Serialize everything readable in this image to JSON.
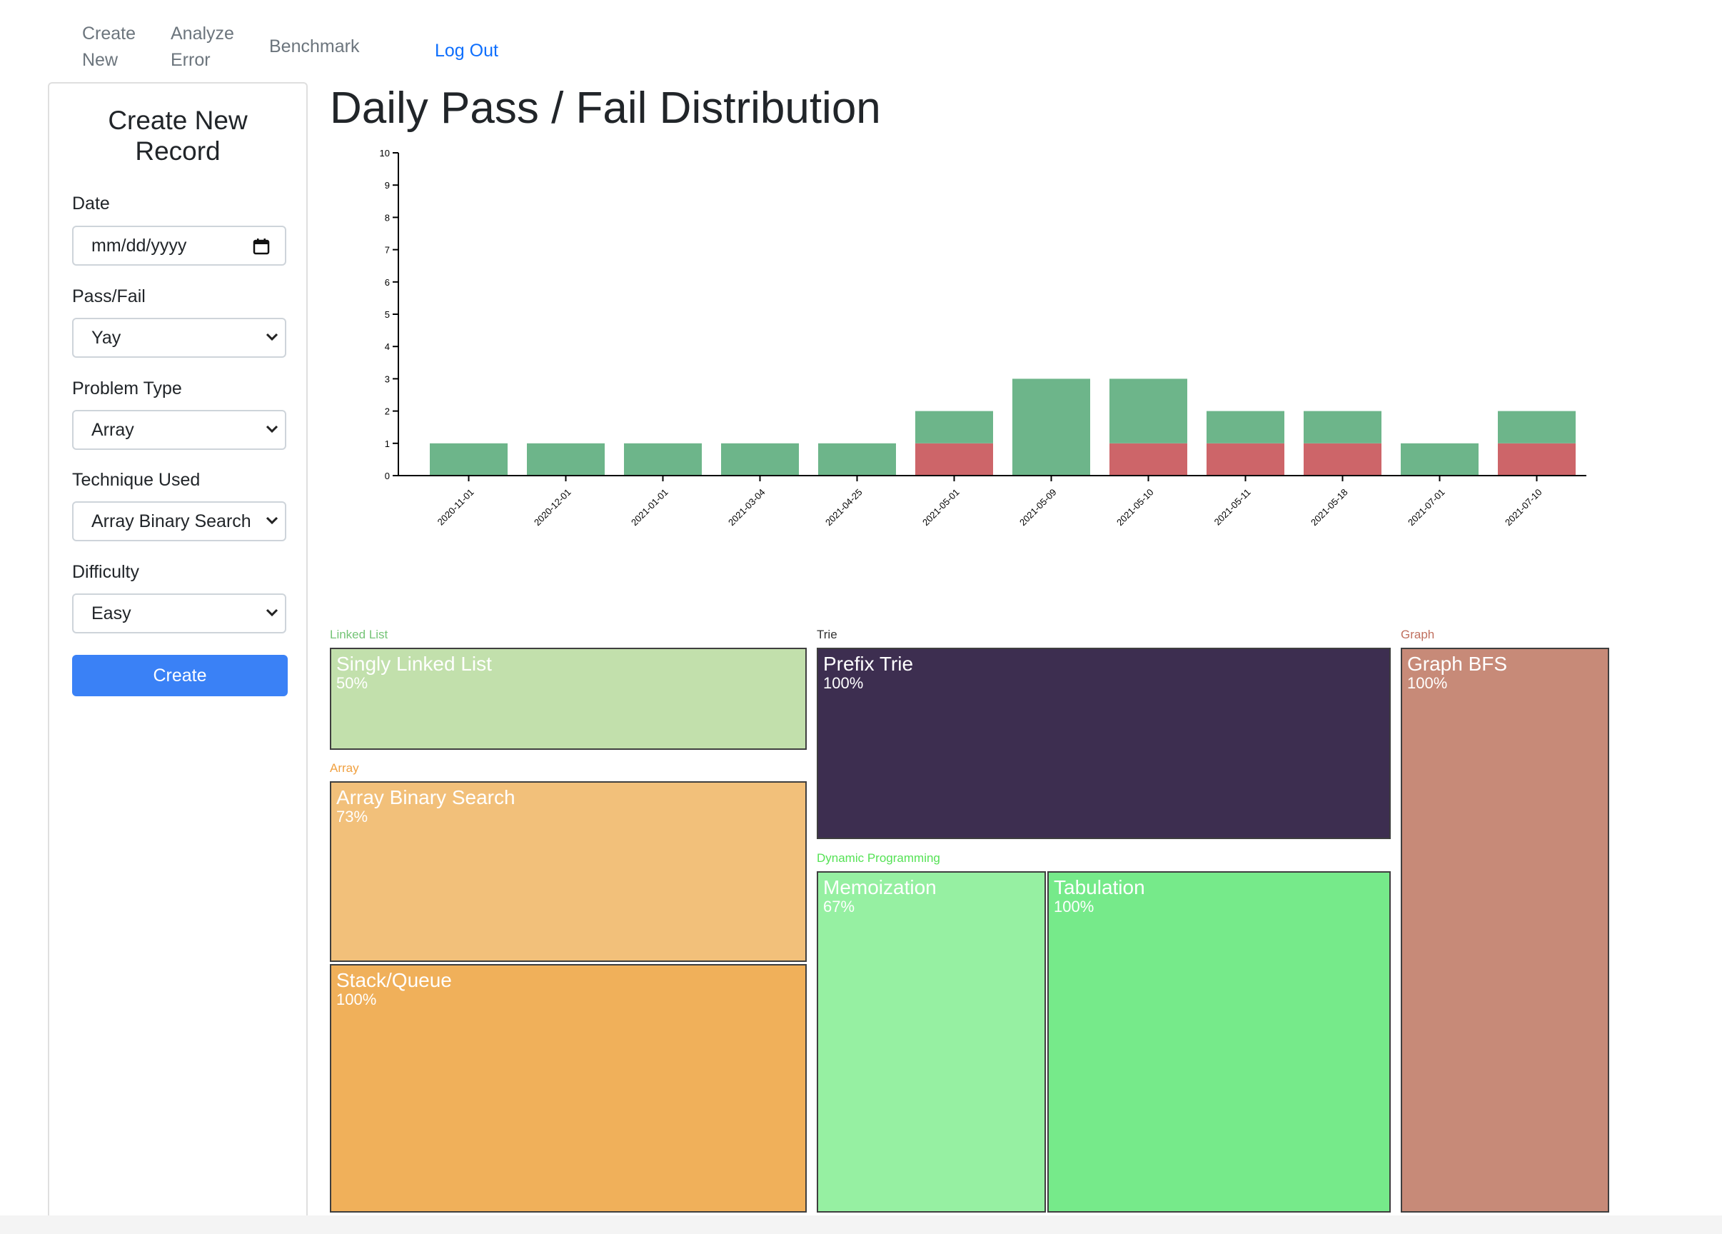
{
  "nav": {
    "create_new_line1": "Create",
    "create_new_line2": "New",
    "analyze_error_line1": "Analyze",
    "analyze_error_line2": "Error",
    "benchmark": "Benchmark",
    "log_out": "Log Out"
  },
  "form": {
    "title_line1": "Create New",
    "title_line2": "Record",
    "date_label": "Date",
    "date_placeholder": "mm/dd/yyyy",
    "pass_fail_label": "Pass/Fail",
    "pass_fail_value": "Yay",
    "problem_type_label": "Problem Type",
    "problem_type_value": "Array",
    "technique_label": "Technique Used",
    "technique_value": "Array Binary Search",
    "difficulty_label": "Difficulty",
    "difficulty_value": "Easy",
    "submit_label": "Create"
  },
  "page_title": "Daily Pass / Fail Distribution",
  "chart_data": {
    "type": "bar",
    "stacked": true,
    "categories": [
      "2020-11-01",
      "2020-12-01",
      "2021-01-01",
      "2021-03-04",
      "2021-04-25",
      "2021-05-01",
      "2021-05-09",
      "2021-05-10",
      "2021-05-11",
      "2021-05-18",
      "2021-07-01",
      "2021-07-10"
    ],
    "series": [
      {
        "color": "#cd6569",
        "values": [
          0,
          0,
          0,
          0,
          0,
          1,
          0,
          1,
          1,
          1,
          0,
          1
        ]
      },
      {
        "color": "#6db58a",
        "values": [
          1,
          1,
          1,
          1,
          1,
          1,
          3,
          2,
          1,
          1,
          1,
          1
        ]
      }
    ],
    "ylim": [
      0,
      10
    ],
    "yticks": [
      0,
      1,
      2,
      3,
      4,
      5,
      6,
      7,
      8,
      9,
      10
    ],
    "grid": false
  },
  "treemap": {
    "groups": [
      {
        "label": "Linked List",
        "color": "#74c476"
      },
      {
        "label": "Array",
        "color": "#f0a040"
      },
      {
        "label": "Trie",
        "color": "#333333"
      },
      {
        "label": "Dynamic Programming",
        "color": "#55e255"
      },
      {
        "label": "Graph",
        "color": "#c0705f"
      }
    ],
    "cells": [
      {
        "name": "Singly Linked List",
        "pct": "50%",
        "color": "#c2e0ac"
      },
      {
        "name": "Array Binary Search",
        "pct": "73%",
        "color": "#f2c07a"
      },
      {
        "name": "Stack/Queue",
        "pct": "100%",
        "color": "#f0b05a"
      },
      {
        "name": "Prefix Trie",
        "pct": "100%",
        "color": "#3d2e50"
      },
      {
        "name": "Memoization",
        "pct": "67%",
        "color": "#96f0a2"
      },
      {
        "name": "Tabulation",
        "pct": "100%",
        "color": "#76ea8a"
      },
      {
        "name": "Graph BFS",
        "pct": "100%",
        "color": "#c78a78"
      }
    ]
  }
}
